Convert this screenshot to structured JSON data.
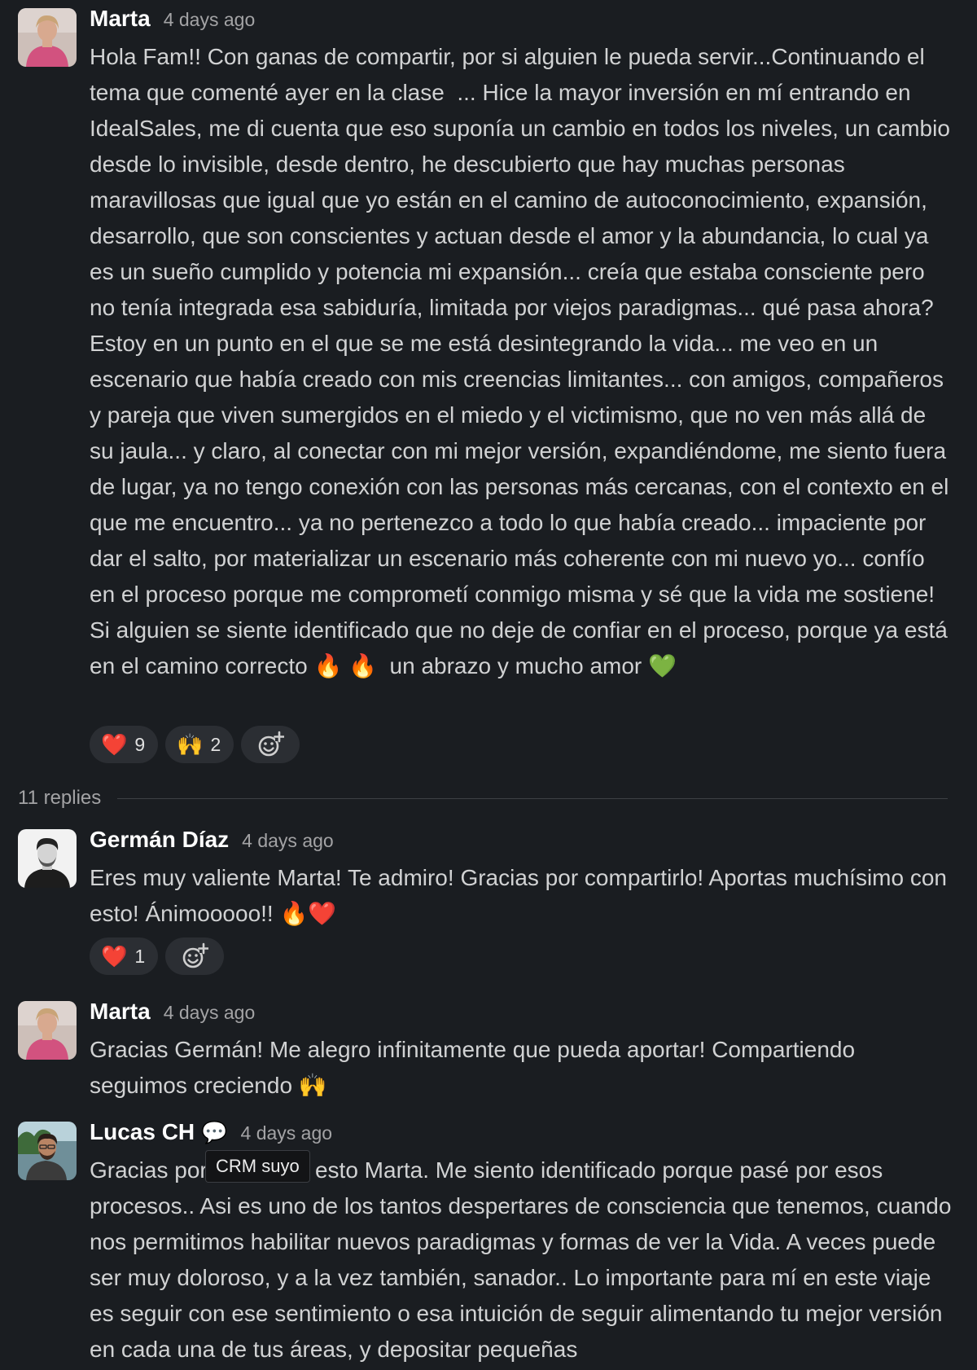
{
  "thread": {
    "parent": {
      "author": "Marta",
      "timestamp": "4 days ago",
      "body": "Hola Fam!! Con ganas de compartir, por si alguien le pueda servir...Continuando el tema que comenté ayer en la clase  ... Hice la mayor inversión en mí entrando en IdealSales, me di cuenta que eso suponía un cambio en todos los niveles, un cambio desde lo invisible, desde dentro, he descubierto que hay muchas personas maravillosas que igual que yo están en el camino de autoconocimiento, expansión,  desarrollo, que son conscientes y actuan desde el amor y la abundancia, lo cual ya es un sueño cumplido y potencia mi expansión... creía que estaba consciente pero no tenía integrada esa sabiduría, limitada por viejos paradigmas... qué pasa ahora? Estoy en un punto en el que se me está desintegrando la vida... me veo en un escenario que había creado con mis creencias limitantes... con amigos, compañeros y pareja que viven sumergidos en el miedo y el victimismo, que no ven más allá de su jaula... y claro, al conectar con mi mejor versión, expandiéndome, me siento fuera de lugar, ya no tengo conexión con las personas más cercanas, con el contexto en el que me encuentro... ya no pertenezco a todo lo que había creado... impaciente por dar el salto, por materializar un escenario más coherente con mi nuevo yo... confío en el proceso porque me comprometí conmigo misma y sé que la vida me sostiene!\nSi alguien se siente identificado que no deje de confiar en el proceso, porque ya está en el camino correcto 🔥 🔥  un abrazo y mucho amor 💚",
      "reactions": [
        {
          "emoji": "❤️",
          "count": "9"
        },
        {
          "emoji": "🙌",
          "count": "2"
        }
      ]
    },
    "replies_label": "11 replies",
    "replies": [
      {
        "author": "Germán Díaz",
        "timestamp": "4 days ago",
        "body": "Eres muy valiente Marta! Te admiro! Gracias por compartirlo! Aportas muchísimo con esto! Ánimooooo!! 🔥❤️",
        "reactions": [
          {
            "emoji": "❤️",
            "count": "1"
          }
        ]
      },
      {
        "author": "Marta",
        "timestamp": "4 days ago",
        "body": "Gracias Germán! Me alegro infinitamente que pueda aportar! Compartiendo seguimos creciendo 🙌"
      },
      {
        "author": "Lucas CH",
        "status_emoji": "💬",
        "timestamp": "4 days ago",
        "body": "Gracias por compartir esto Marta. Me siento identificado porque pasé por esos procesos.. Asi es uno de los tantos despertares de consciencia que tenemos, cuando nos permitimos habilitar nuevos paradigmas y formas de ver la Vida. A veces puede ser muy doloroso, y a la vez también, sanador.. Lo importante para mí en este viaje es seguir con ese sentimiento o esa intuición de seguir alimentando tu mejor versión en cada una de tus áreas, y depositar pequeñas",
        "status_tooltip": "CRM suyo"
      }
    ]
  },
  "icons": {
    "add_reaction": "add-reaction-icon"
  },
  "colors": {
    "background": "#1a1d21",
    "reaction_pill": "#2b2e33",
    "text": "#d1d2d3"
  }
}
